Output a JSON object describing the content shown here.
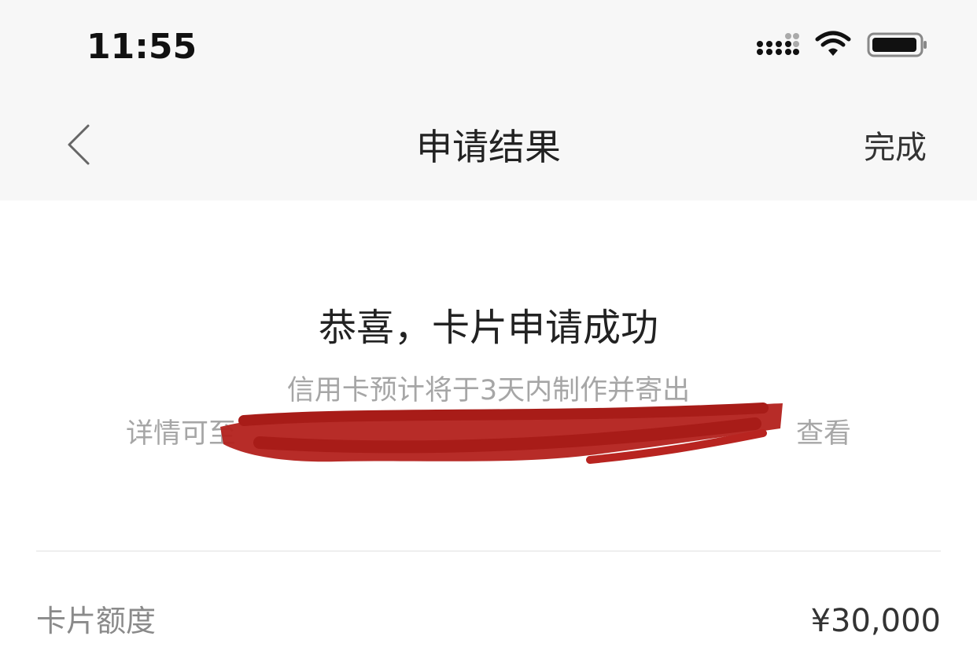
{
  "status_bar": {
    "time": "11:55",
    "icons": [
      "signal-icon",
      "wifi-icon",
      "battery-icon"
    ]
  },
  "nav": {
    "back_icon": "chevron-left-icon",
    "title": "申请结果",
    "done_label": "完成"
  },
  "result": {
    "title": "恭喜，卡片申请成功",
    "line1": "信用卡预计将于3天内制作并寄出",
    "line2_prefix": "详情可至",
    "line2_suffix": "查看"
  },
  "details": [
    {
      "label": "卡片额度",
      "value": "¥30,000"
    }
  ],
  "colors": {
    "header_bg": "#f7f7f7",
    "redaction": "#b3211c",
    "secondary_text": "#a6a6a6"
  }
}
